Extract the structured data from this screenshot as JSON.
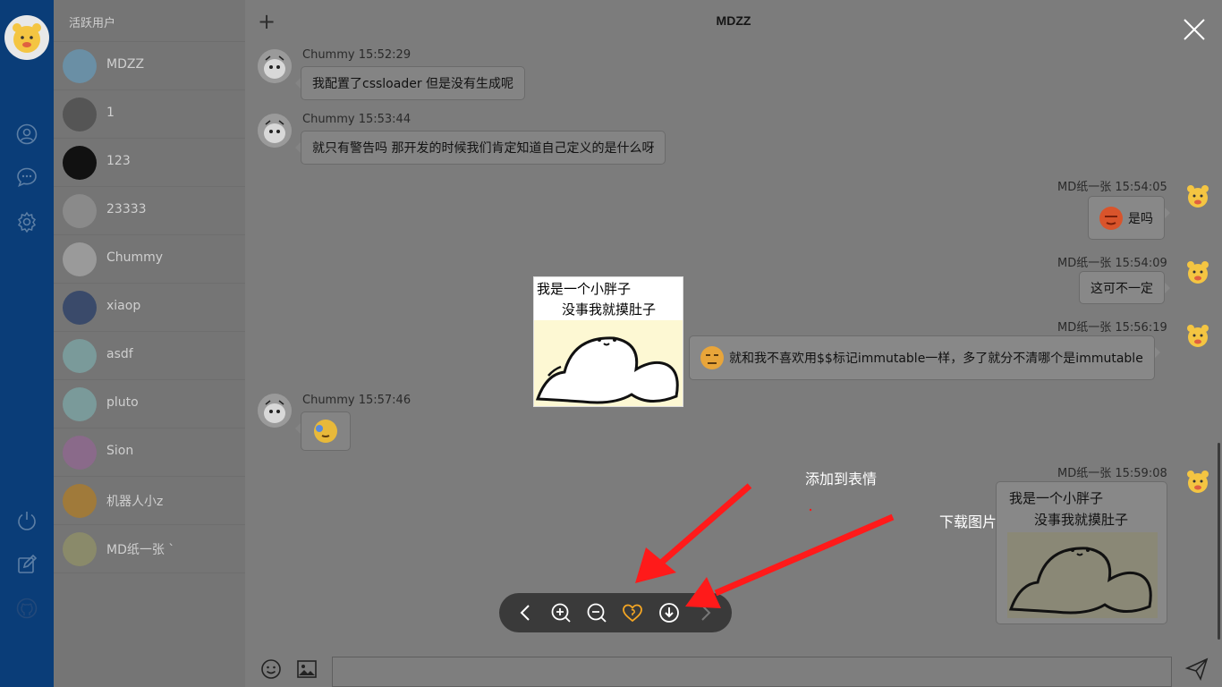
{
  "sidebar": {
    "header": "活跃用户",
    "users": [
      {
        "name": "MDZZ"
      },
      {
        "name": "1"
      },
      {
        "name": "123"
      },
      {
        "name": "23333"
      },
      {
        "name": "Chummy"
      },
      {
        "name": "xiaop"
      },
      {
        "name": "asdf"
      },
      {
        "name": "pluto"
      },
      {
        "name": "Sion"
      },
      {
        "name": "机器人小z"
      },
      {
        "name": "MD纸一张 `"
      }
    ]
  },
  "chat": {
    "title": "MDZZ",
    "messages": [
      {
        "sender": "Chummy",
        "time": "15:52:29",
        "meta": "Chummy 15:52:29",
        "text": "我配置了cssloader 但是没有生成呢"
      },
      {
        "sender": "Chummy",
        "time": "15:53:44",
        "meta": "Chummy 15:53:44",
        "text": "就只有警告吗 那开发的时候我们肯定知道自己定义的是什么呀"
      },
      {
        "sender": "MD纸一张",
        "time": "15:54:05",
        "meta": "MD纸一张 15:54:05",
        "text": "是吗"
      },
      {
        "sender": "MD纸一张",
        "time": "15:54:09",
        "meta": "MD纸一张 15:54:09",
        "text": "这可不一定"
      },
      {
        "sender": "MD纸一张",
        "time": "15:56:19",
        "meta": "MD纸一张 15:56:19",
        "text": "就和我不喜欢用$$标记immutable一样，多了就分不清哪个是immutable"
      },
      {
        "sender": "Chummy",
        "time": "15:57:46",
        "meta": "Chummy 15:57:46",
        "text": ""
      },
      {
        "sender": "MD纸一张",
        "time": "15:59:08",
        "meta": "MD纸一张 15:59:08",
        "text": ""
      }
    ]
  },
  "sticker": {
    "line1": "我是一个小胖子",
    "line2": "没事我就摸肚子"
  },
  "annotations": {
    "add_to_emoji": "添加到表情",
    "download_image": "下载图片"
  },
  "colors": {
    "rail": "#0a3d78",
    "arrow": "#ff1a1a",
    "heart": "#f5a623",
    "toolbar": "#3a3a3a"
  },
  "icons": [
    "user-icon",
    "chat-icon",
    "settings-icon",
    "power-icon",
    "edit-icon",
    "github-icon",
    "plus-icon",
    "emoji-icon",
    "image-icon",
    "send-icon",
    "close-icon",
    "prev-icon",
    "zoom-in-icon",
    "zoom-out-icon",
    "heart-icon",
    "download-icon",
    "next-icon"
  ]
}
